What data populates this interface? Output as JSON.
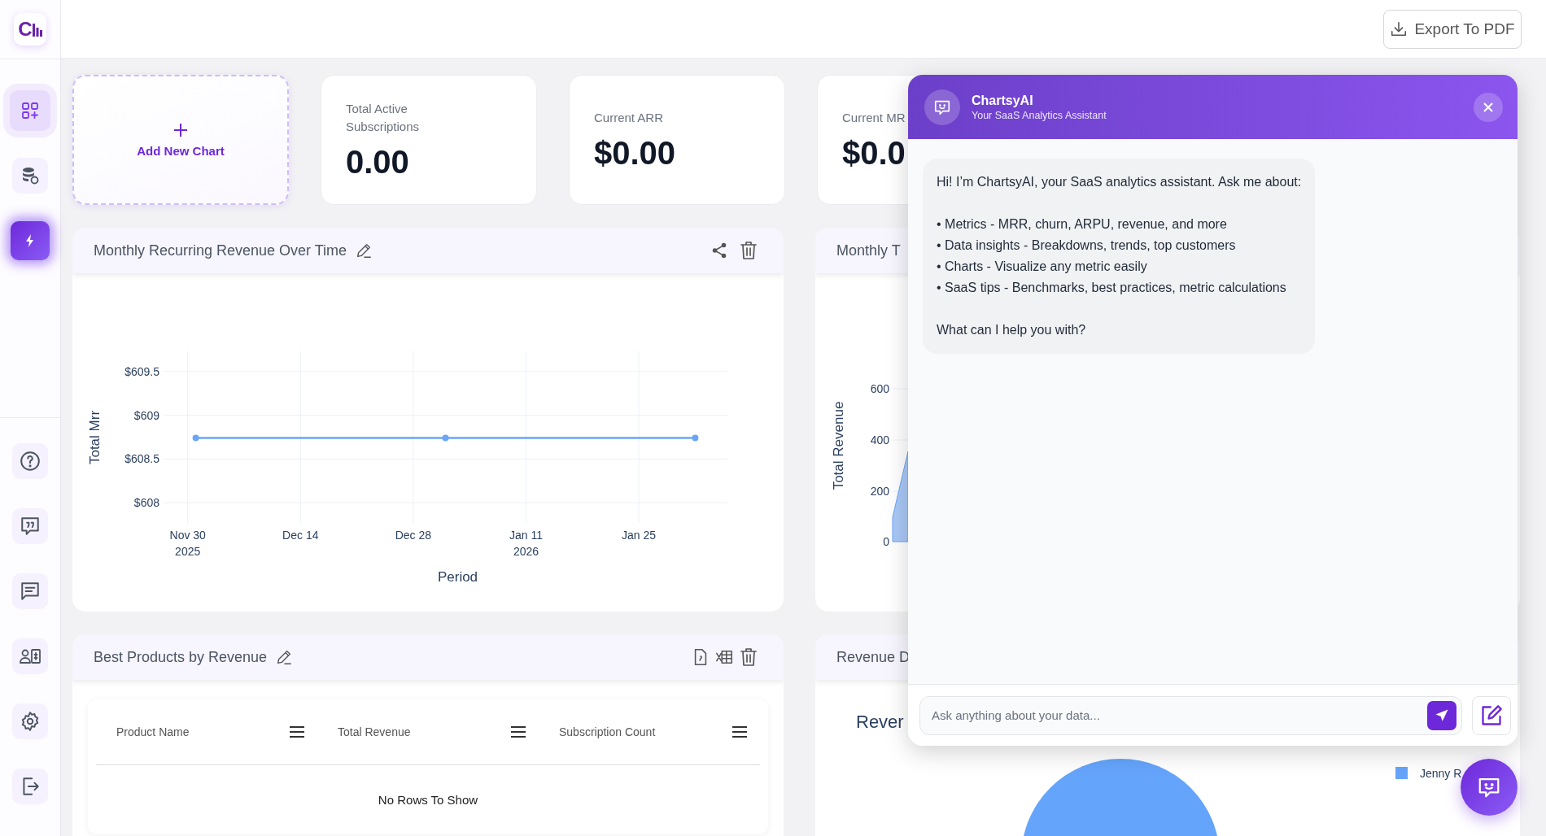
{
  "sidebar": {
    "logo": "C",
    "nav_items": [
      {
        "kind": "grid",
        "selected": true
      },
      {
        "kind": "database",
        "selected": false
      }
    ],
    "chat_toggle": {
      "on": true
    },
    "bottom_items": [
      {
        "kind": "help"
      },
      {
        "kind": "feedback"
      },
      {
        "kind": "messages"
      },
      {
        "kind": "billing"
      },
      {
        "kind": "settings"
      },
      {
        "kind": "logout"
      }
    ]
  },
  "header": {
    "export_button": "Export To PDF"
  },
  "add_chart": {
    "label": "Add New Chart"
  },
  "stats": [
    {
      "label": "Total Active Subscriptions",
      "value": "0.00"
    },
    {
      "label": "Current ARR",
      "value": "$0.00"
    },
    {
      "label": "Current MR",
      "value": "$0.0"
    }
  ],
  "panels": [
    {
      "kind": "line_chart",
      "title": "Monthly Recurring Revenue Over Time",
      "actions": [
        {
          "kind": "share"
        },
        {
          "kind": "delete"
        }
      ],
      "chart_data": {
        "type": "line",
        "xlabel": "Period",
        "ylabel": "Total Mrr",
        "x": [
          "2025-12-01",
          "2026-01-01",
          "2026-02-01"
        ],
        "grid": true,
        "series": [
          {
            "color": "#6aa5f8",
            "marker": true,
            "values": [
              608.74,
              608.74,
              608.74
            ]
          }
        ],
        "xlim": [
          "2025-11-27",
          "2026-02-05"
        ],
        "ylim": [
          607.77,
          609.73
        ],
        "xticks": [
          {
            "value": "2025-11-30",
            "label": "Nov 30\n2025"
          },
          {
            "value": "2025-12-14",
            "label": "Dec 14"
          },
          {
            "value": "2025-12-28",
            "label": "Dec 28"
          },
          {
            "value": "2026-01-11",
            "label": "Jan 11\n2026"
          },
          {
            "value": "2026-01-25",
            "label": "Jan 25"
          }
        ],
        "yticks": [
          {
            "value": 608,
            "label": "$608"
          },
          {
            "value": 608.5,
            "label": "$608.5"
          },
          {
            "value": 609,
            "label": "$609"
          },
          {
            "value": 609.5,
            "label": "$609.5"
          }
        ]
      }
    },
    {
      "kind": "area_chart",
      "title": "Monthly T",
      "y_axis_title": "Total Revenue",
      "y_tick_labels": [
        "600",
        "400",
        "200",
        "0"
      ]
    },
    {
      "kind": "table",
      "title": "Best Products by Revenue",
      "actions": [
        {
          "kind": "pdf"
        },
        {
          "kind": "excel"
        },
        {
          "kind": "delete"
        }
      ],
      "columns": [
        "Product Name",
        "Total Revenue",
        "Subscription Count"
      ],
      "empty_message": "No Rows To Show"
    },
    {
      "kind": "pie_chart",
      "title": "Revenue D",
      "chart_title": "Rever",
      "legend": [
        {
          "label": "Jenny R",
          "color": "#64a4fa"
        }
      ]
    }
  ],
  "chat": {
    "title": "ChartsyAI",
    "subtitle": "Your SaaS Analytics Assistant",
    "message": {
      "intro": "Hi! I’m ChartsyAI, your SaaS analytics assistant. Ask me about:",
      "bullets": [
        "• Metrics - MRR, churn, ARPU, revenue, and more",
        "• Data insights - Breakdowns, trends, top customers",
        "• Charts - Visualize any metric easily",
        "• SaaS tips - Benchmarks, best practices, metric calculations"
      ],
      "outro": "What can I help you with?"
    },
    "input": {
      "placeholder": "Ask anything about your data..."
    }
  }
}
